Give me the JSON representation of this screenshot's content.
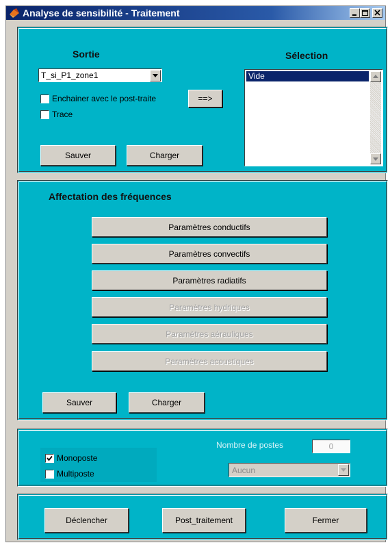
{
  "window": {
    "title": "Analyse de sensibilité - Traitement"
  },
  "sortie": {
    "heading": "Sortie",
    "dropdown_value": "T_si_P1_zone1",
    "checkbox_enchainer_label": "Enchainer avec le post-traite",
    "checkbox_enchainer_checked": false,
    "checkbox_trace_label": "Trace",
    "checkbox_trace_checked": false,
    "arrow_button_label": "==>",
    "save_label": "Sauver",
    "load_label": "Charger"
  },
  "selection": {
    "heading": "Sélection",
    "items": [
      "Vide"
    ]
  },
  "frequences": {
    "heading": "Affectation des fréquences",
    "buttons": [
      {
        "label": "Paramètres conductifs",
        "enabled": true
      },
      {
        "label": "Paramètres convectifs",
        "enabled": true
      },
      {
        "label": "Paramètres radiatifs",
        "enabled": true
      },
      {
        "label": "Paramètres hydriques",
        "enabled": false
      },
      {
        "label": "Paramètres aérauliques",
        "enabled": false
      },
      {
        "label": "Paramètres acoustiques",
        "enabled": false
      }
    ],
    "save_label": "Sauver",
    "load_label": "Charger"
  },
  "postes": {
    "monoposte_label": "Monoposte",
    "monoposte_checked": true,
    "multiposte_label": "Multiposte",
    "multiposte_checked": false,
    "nombre_label": "Nombre de postes",
    "nombre_value": "0",
    "select_value": "Aucun"
  },
  "actions": {
    "declencher_label": "Déclencher",
    "post_traitement_label": "Post_traitement",
    "fermer_label": "Fermer"
  },
  "colors": {
    "panel_bg": "#00b4c8",
    "titlebar_start": "#0a246a",
    "selection_bg": "#0a246a"
  }
}
